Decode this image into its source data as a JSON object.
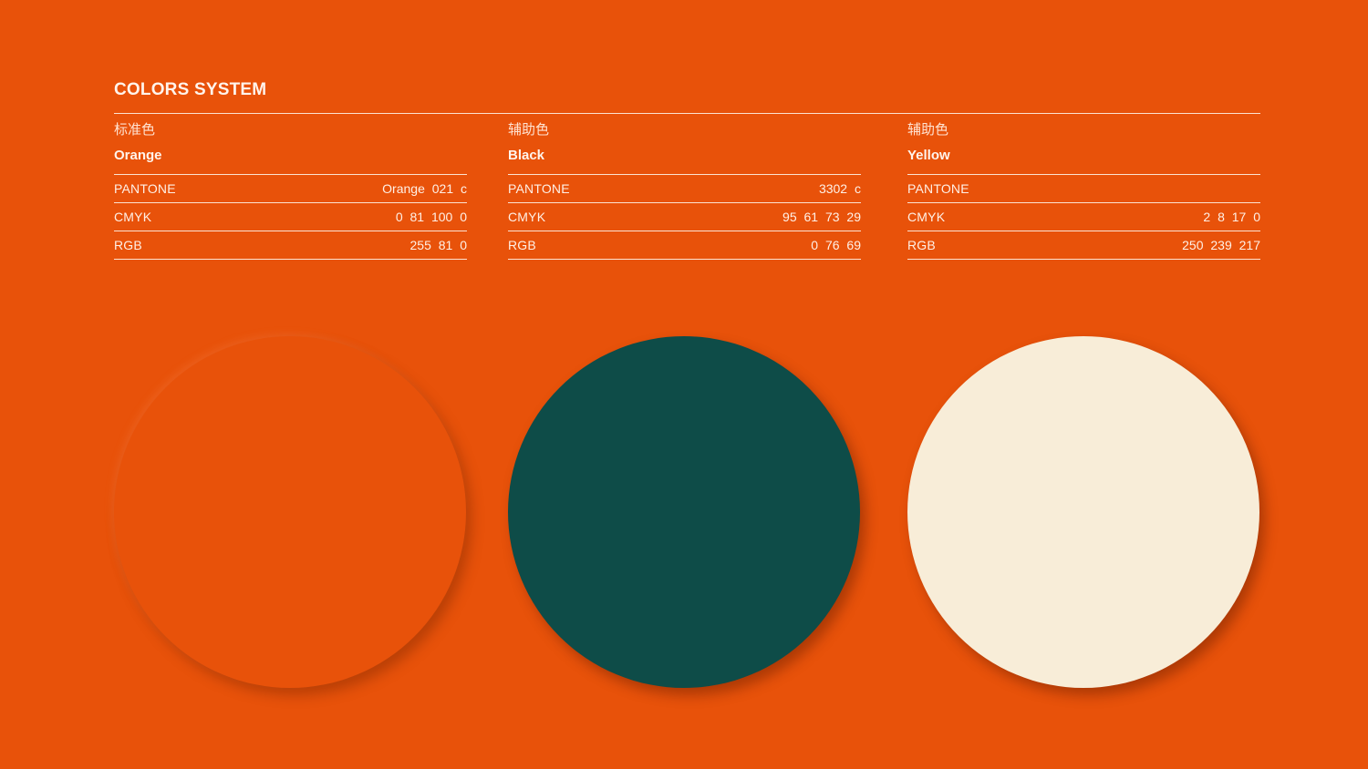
{
  "title": "COLORS SYSTEM",
  "colors": [
    {
      "category": "标准色",
      "name": "Orange",
      "pantone_label": "PANTONE",
      "pantone": "Orange 021 c",
      "cmyk_label": "CMYK",
      "cmyk": "0 81 100 0",
      "rgb_label": "RGB",
      "rgb": "255 81 0",
      "swatch_color": "#E8520A"
    },
    {
      "category": "辅助色",
      "name": "Black",
      "pantone_label": "PANTONE",
      "pantone": "3302 c",
      "cmyk_label": "CMYK",
      "cmyk": "95 61 73 29",
      "rgb_label": "RGB",
      "rgb": "0 76 69",
      "swatch_color": "#0E4C48"
    },
    {
      "category": "辅助色",
      "name": "Yellow",
      "pantone_label": "PANTONE",
      "pantone": "",
      "cmyk_label": "CMYK",
      "cmyk": "2 8 17 0",
      "rgb_label": "RGB",
      "rgb": "250 239 217",
      "swatch_color": "#F8EDD8"
    }
  ]
}
